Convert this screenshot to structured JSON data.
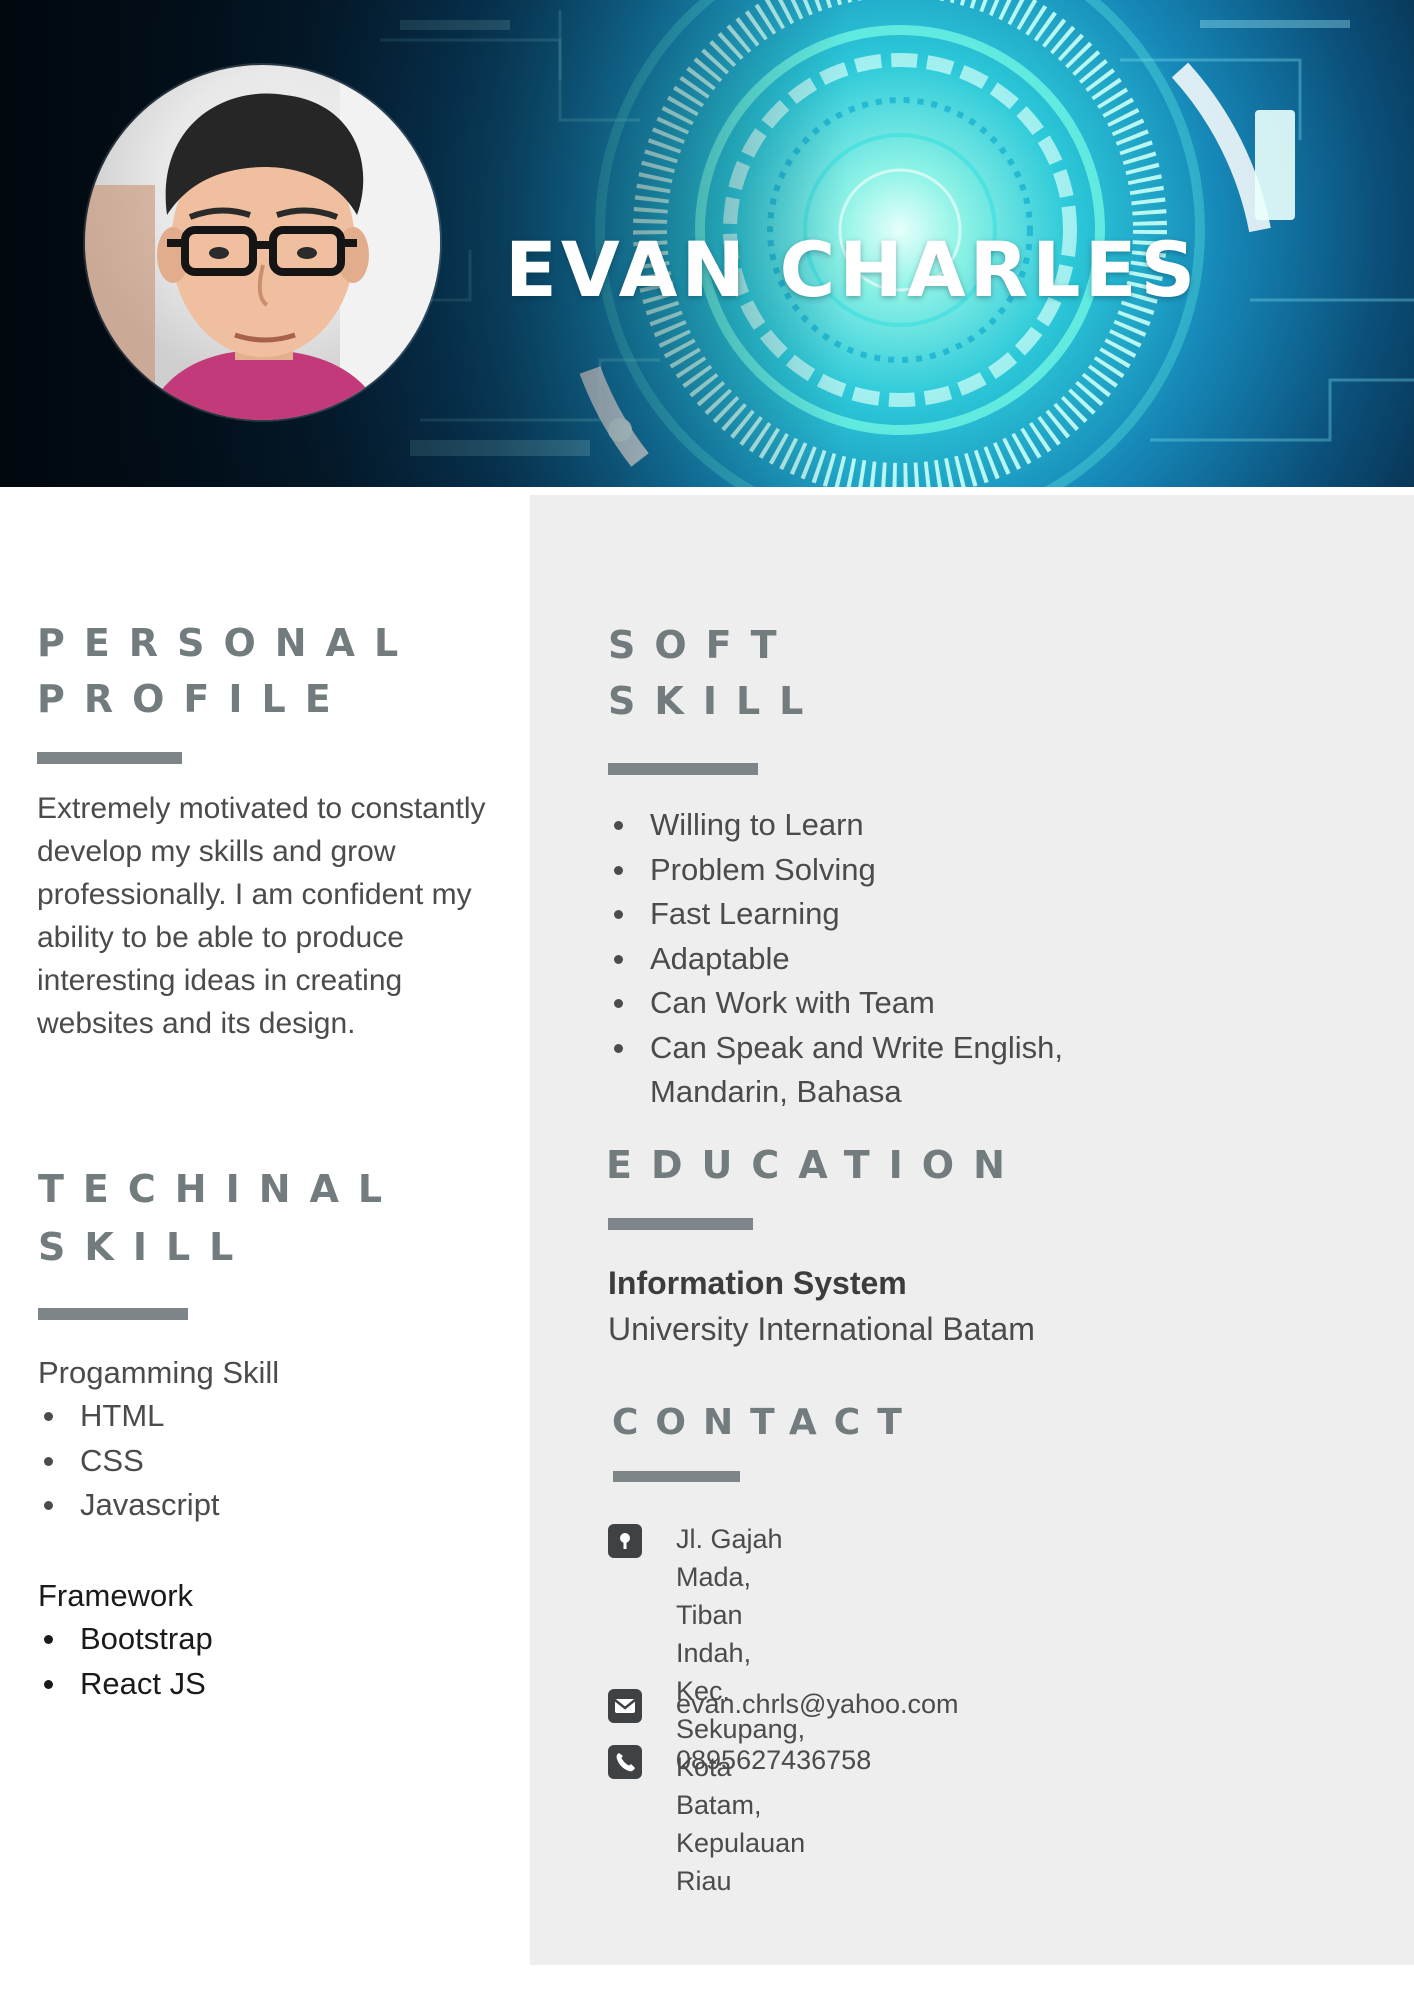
{
  "header": {
    "name": "EVAN CHARLES"
  },
  "personal_profile": {
    "heading": "PERSONAL\nPROFILE",
    "text": "Extremely motivated to constantly develop my skills and grow professionally. I am confident my ability to be able to produce interesting ideas in creating websites and its design."
  },
  "technical_skill": {
    "heading": "TECHINAL\nSKILL",
    "programming_label": "Progamming Skill",
    "programming_items": [
      "HTML",
      "CSS",
      "Javascript"
    ],
    "framework_label": "Framework",
    "framework_items": [
      "Bootstrap",
      "React JS"
    ]
  },
  "soft_skill": {
    "heading": "SOFT\nSKILL",
    "items": [
      "Willing to Learn",
      "Problem Solving",
      "Fast Learning",
      "Adaptable",
      "Can Work with Team",
      "Can Speak and Write English, Mandarin, Bahasa"
    ]
  },
  "education": {
    "heading": "EDUCATION",
    "degree": "Information System",
    "school": "University International Batam"
  },
  "contact": {
    "heading": "CONTACT",
    "address": "Jl. Gajah Mada, Tiban\nIndah, Kec. Sekupang,\nKota Batam,\nKepulauan Riau",
    "email": "evan.chrls@yahoo.com",
    "phone": "0895627436758",
    "icons": [
      "location-icon",
      "email-icon",
      "phone-icon"
    ]
  }
}
